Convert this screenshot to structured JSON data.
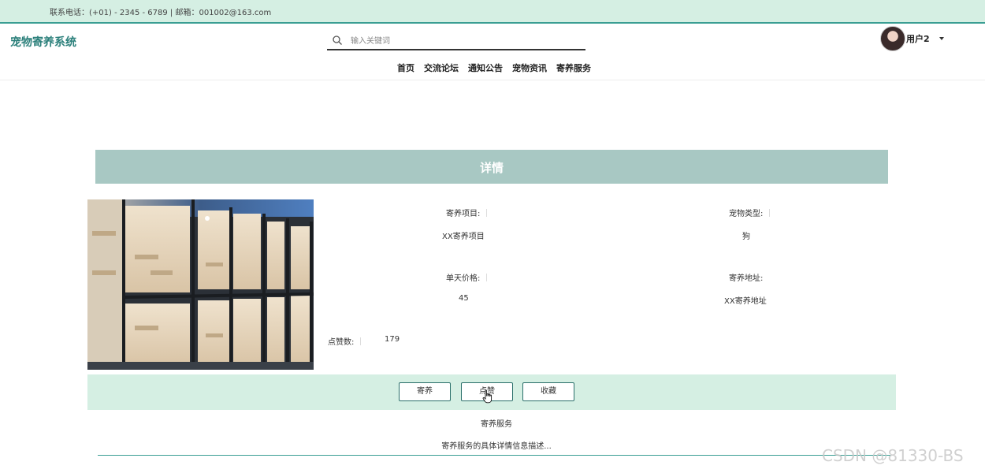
{
  "topbar": {
    "contact": "联系电话：(+01) - 2345 - 6789 | 邮箱：001002@163.com"
  },
  "header": {
    "logo": "宠物寄养系统",
    "search_placeholder": "输入关键词",
    "user_name": "用户2",
    "nav": [
      {
        "label": "首页"
      },
      {
        "label": "交流论坛"
      },
      {
        "label": "通知公告"
      },
      {
        "label": "宠物资讯"
      },
      {
        "label": "寄养服务"
      }
    ]
  },
  "detail": {
    "title": "详情",
    "fields": {
      "project_label": "寄养项目:",
      "project_value": "XX寄养项目",
      "pet_type_label": "宠物类型:",
      "pet_type_value": "狗",
      "price_label": "单天价格:",
      "price_value": "45",
      "address_label": "寄养地址:",
      "address_value": "XX寄养地址",
      "likes_label": "点赞数:",
      "likes_value": "179"
    },
    "buttons": {
      "board": "寄养",
      "like": "点赞",
      "favorite": "收藏"
    }
  },
  "service": {
    "title": "寄养服务",
    "description": "寄养服务的具体详情信息描述..."
  },
  "watermark": "CSDN @81330-BS",
  "colors": {
    "accent": "#3a9e93",
    "light_green": "#d5efe3",
    "detail_bar": "#a8c8c3",
    "logo": "#2a7f7a"
  },
  "icons": {
    "search": "search-icon",
    "caret": "caret-down-icon",
    "cursor": "hand-pointer-icon"
  }
}
